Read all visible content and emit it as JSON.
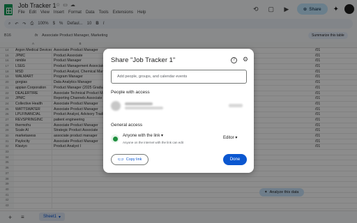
{
  "app": {
    "title": "Job Tracker 1",
    "menu": [
      "File",
      "Edit",
      "View",
      "Insert",
      "Format",
      "Data",
      "Tools",
      "Extensions",
      "Help"
    ]
  },
  "header": {
    "share_label": "Share",
    "share_icon": "globe-icon"
  },
  "toolbar": {
    "zoom": "100%",
    "font": "Defaul...",
    "font_size": "10"
  },
  "formula_bar": {
    "cell_ref": "B16",
    "fx": "fx",
    "content": "Associate Product Manager, Marketing",
    "summarize_label": "Summarize this table"
  },
  "grid": {
    "columns": [
      "A",
      "B"
    ],
    "rows": [
      {
        "n": "14",
        "a": "Argon Medical Devices",
        "b": "Associate Product Manager"
      },
      {
        "n": "15",
        "a": "JPMC",
        "b": "Product Associate"
      },
      {
        "n": "16",
        "a": "nimble",
        "b": "Product Manager"
      },
      {
        "n": "17",
        "a": "LSEG",
        "b": "Product Management Associate"
      },
      {
        "n": "18",
        "a": "MSD",
        "b": "Product Analyst, Chemical Manufacturing"
      },
      {
        "n": "19",
        "a": "WALMART",
        "b": "Program Manager"
      },
      {
        "n": "20",
        "a": "gorgias",
        "b": "Data Analytics Manager"
      },
      {
        "n": "21",
        "a": "appian Corporation",
        "b": "Product Manager (2025 Graduates)"
      },
      {
        "n": "22",
        "a": "DEALERTIRE",
        "b": "Associate Technical Product Manager"
      },
      {
        "n": "23",
        "a": "JPMC",
        "b": "Reporting Channels Associate"
      },
      {
        "n": "24",
        "a": "Collective Health",
        "b": "Associate Product Manager"
      },
      {
        "n": "25",
        "a": "WATTSWATER",
        "b": "Associate Product Manager"
      },
      {
        "n": "26",
        "a": "LPLFINANCIAL",
        "b": "Product Analyst, Advisory Trading"
      },
      {
        "n": "27",
        "a": "REVSPRINGINC",
        "b": "patient engineering"
      },
      {
        "n": "28",
        "a": "thermofru",
        "b": "Associate Product Manager"
      },
      {
        "n": "29",
        "a": "Scale AI",
        "b": "Strategic Product Associate"
      },
      {
        "n": "30",
        "a": "marketaxess",
        "b": "associate product manager"
      },
      {
        "n": "31",
        "a": "Paylocity",
        "b": "Associate Product Manager"
      },
      {
        "n": "32",
        "a": "Klaviyo",
        "b": "Product Analyst I"
      },
      {
        "n": "33",
        "a": "",
        "b": ""
      },
      {
        "n": "34",
        "a": "",
        "b": ""
      },
      {
        "n": "35",
        "a": "",
        "b": ""
      },
      {
        "n": "36",
        "a": "",
        "b": ""
      },
      {
        "n": "37",
        "a": "",
        "b": ""
      },
      {
        "n": "38",
        "a": "",
        "b": ""
      },
      {
        "n": "39",
        "a": "",
        "b": ""
      },
      {
        "n": "40",
        "a": "",
        "b": ""
      },
      {
        "n": "41",
        "a": "",
        "b": ""
      },
      {
        "n": "42",
        "a": "",
        "b": ""
      },
      {
        "n": "43",
        "a": "",
        "b": ""
      }
    ],
    "right_col_values": [
      "/01",
      "/01",
      "/01",
      "/01",
      "/01",
      "/01",
      "/01",
      "/01",
      "/01",
      "/01",
      "/01",
      "/01",
      "/01",
      "/01",
      "/01",
      "/01",
      "/01",
      "/01",
      "/01"
    ]
  },
  "analyze_label": "Analyze this data",
  "sheet": {
    "tab_label": "Sheet1"
  },
  "dialog": {
    "title": "Share \"Job Tracker 1\"",
    "input_placeholder": "Add people, groups, and calendar events",
    "people_heading": "People with access",
    "general_heading": "General access",
    "access_main": "Anyone with the link",
    "access_sub": "Anyone on the internet with the link can edit",
    "role": "Editor",
    "copy_link": "Copy link",
    "done": "Done"
  }
}
